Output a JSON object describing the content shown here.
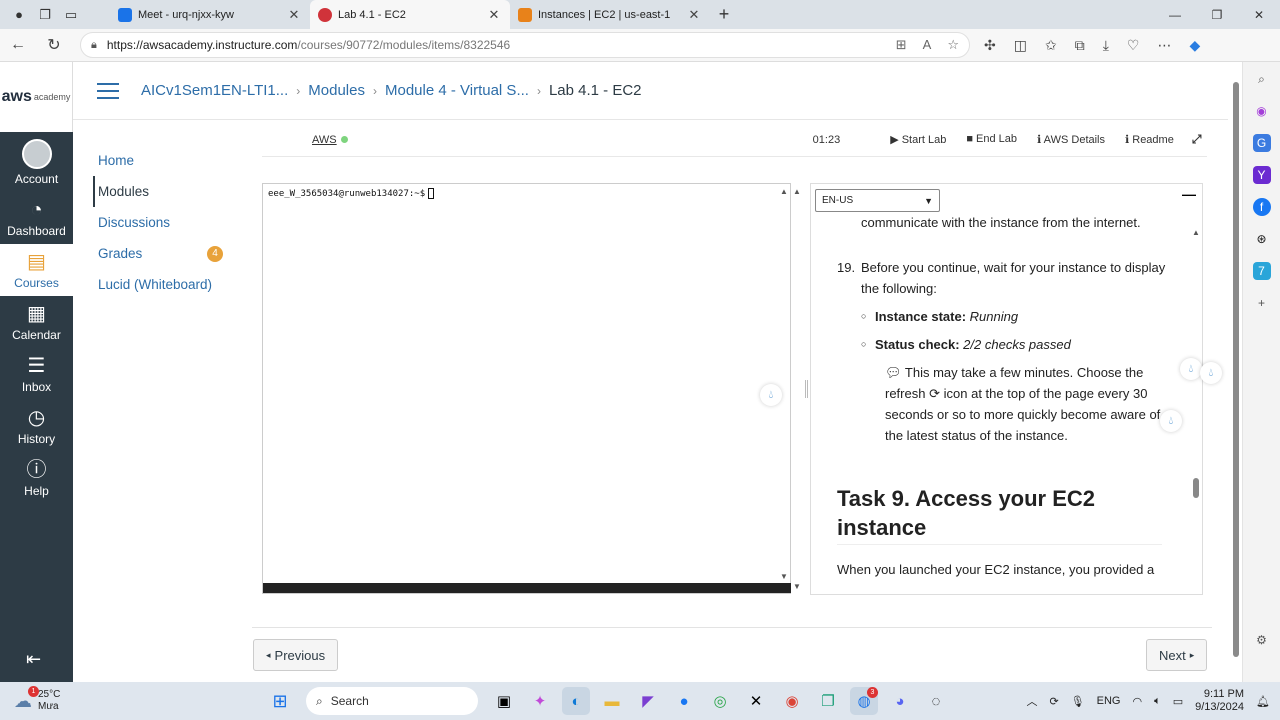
{
  "browser": {
    "tabs": [
      {
        "title": "Meet - urq-njxx-kyw",
        "color": "#1a73e8"
      },
      {
        "title": "Lab 4.1 - EC2",
        "color": "#d0333a"
      },
      {
        "title": "Instances | EC2 | us-east-1",
        "color": "#e8821a"
      }
    ],
    "url_host": "https://awsacademy.instructure.com",
    "url_path": "/courses/90772/modules/items/8322546"
  },
  "global_nav": {
    "brand_main": "aws",
    "brand_sub": "academy",
    "items": [
      {
        "label": "Account",
        "icon": "user-icon"
      },
      {
        "label": "Dashboard",
        "icon": "dashboard-icon"
      },
      {
        "label": "Courses",
        "icon": "courses-icon"
      },
      {
        "label": "Calendar",
        "icon": "calendar-icon"
      },
      {
        "label": "Inbox",
        "icon": "inbox-icon"
      },
      {
        "label": "History",
        "icon": "history-icon"
      },
      {
        "label": "Help",
        "icon": "help-icon"
      }
    ]
  },
  "breadcrumb": [
    "AICv1Sem1EN-LTI1...",
    "Modules",
    "Module 4 - Virtual S...",
    "Lab 4.1 - EC2"
  ],
  "course_nav": {
    "items": [
      "Home",
      "Modules",
      "Discussions",
      "Grades",
      "Lucid (Whiteboard)"
    ],
    "grades_badge": "4"
  },
  "lab_toolbar": {
    "aws_label": "AWS",
    "timer": "01:23",
    "start_lab": "Start Lab",
    "end_lab": "End Lab",
    "aws_details": "AWS Details",
    "readme": "Readme"
  },
  "terminal": {
    "prompt": "eee_W_3565034@runweb134027:~$"
  },
  "instructions": {
    "language": "EN-US",
    "fragment": "communicate with the instance from the internet.",
    "step_num": "19.",
    "step_text": "Before you continue, wait for your instance to display the following:",
    "state_label": "Instance state:",
    "state_value": "Running",
    "status_label": "Status check:",
    "status_value": "2/2 checks passed",
    "note_a": "This may take a few minutes. Choose the refresh",
    "note_b": "icon at the top of the page every 30 seconds or so to more quickly become aware of the latest status of the instance.",
    "task_heading": "Task 9. Access your EC2 instance",
    "task_para": "When you launched your EC2 instance, you provided a"
  },
  "footer": {
    "previous": "Previous",
    "next": "Next"
  },
  "taskbar": {
    "temp": "25°C",
    "weather": "Mưa",
    "weather_badge": "1",
    "search": "Search",
    "lang": "ENG",
    "time": "9:11 PM",
    "date": "9/13/2024",
    "app_badge": "3"
  }
}
